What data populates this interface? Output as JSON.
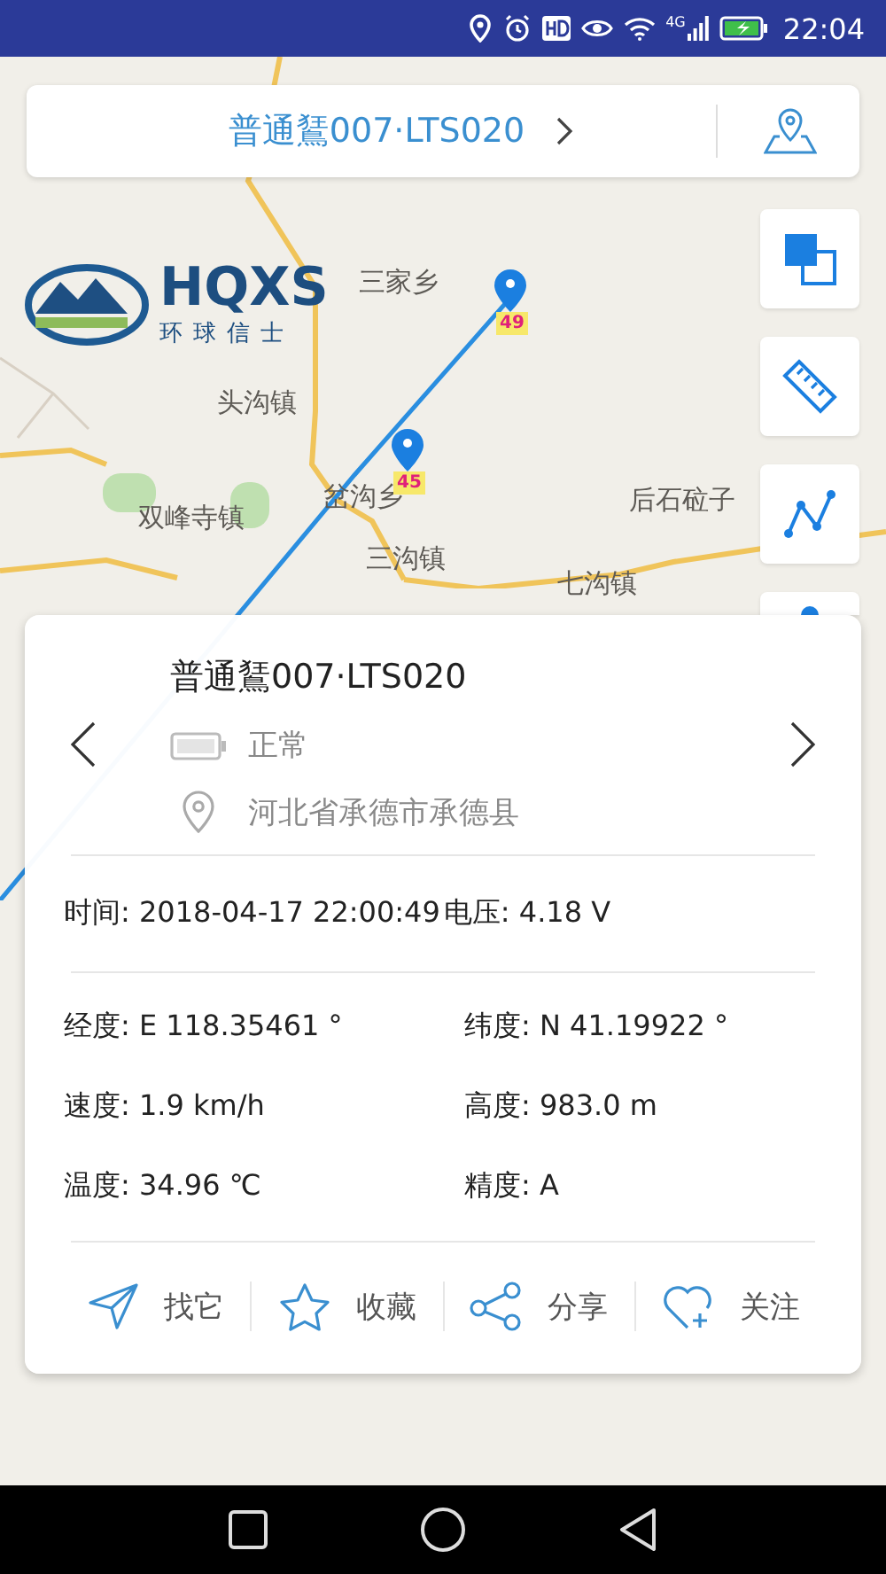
{
  "status_bar": {
    "network": "4G",
    "time": "22:04"
  },
  "header": {
    "title": "普通鵟007·LTS020"
  },
  "map": {
    "logo": {
      "name": "HQXS",
      "subtitle": "环球信士"
    },
    "places": [
      {
        "name": "三家乡"
      },
      {
        "name": "头沟镇"
      },
      {
        "name": "双峰寺镇"
      },
      {
        "name": "岔沟乡"
      },
      {
        "name": "三沟镇"
      },
      {
        "name": "七沟镇"
      },
      {
        "name": "后石砬子"
      }
    ],
    "markers": [
      {
        "label": "49"
      },
      {
        "label": "45"
      }
    ]
  },
  "card": {
    "title": "普通鵟007·LTS020",
    "battery_status": "正常",
    "address": "河北省承德市承德县",
    "time_label": "时间:",
    "time": "2018-04-17 22:00:49",
    "voltage_label": "电压:",
    "voltage": "4.18 V",
    "fields": [
      {
        "label": "经度:",
        "value": "E 118.35461 °"
      },
      {
        "label": "纬度:",
        "value": "N 41.19922 °"
      },
      {
        "label": "速度:",
        "value": "1.9 km/h"
      },
      {
        "label": "高度:",
        "value": "983.0 m"
      },
      {
        "label": "温度:",
        "value": "34.96 ℃"
      },
      {
        "label": "精度:",
        "value": "A"
      }
    ],
    "actions": [
      {
        "kind": "navigate",
        "label": "找它"
      },
      {
        "kind": "favorite",
        "label": "收藏"
      },
      {
        "kind": "share",
        "label": "分享"
      },
      {
        "kind": "follow",
        "label": "关注"
      }
    ]
  }
}
